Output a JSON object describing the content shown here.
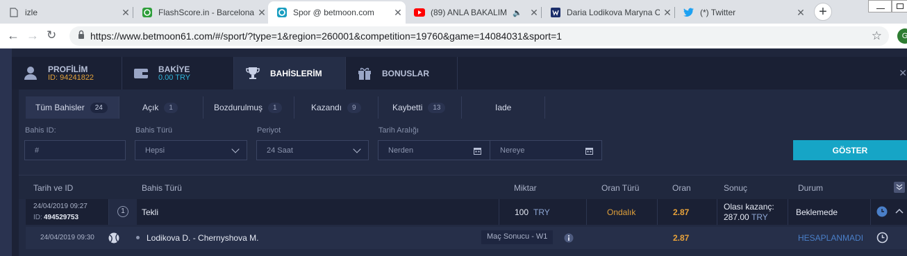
{
  "browser": {
    "tabs": [
      {
        "title": "izle",
        "icon": "page-icon"
      },
      {
        "title": "FlashScore.in - Barcelona",
        "icon": "flashscore-icon"
      },
      {
        "title": "Spor @ betmoon.com",
        "icon": "betmoon-icon",
        "active": true
      },
      {
        "title": "(89) ANLA BAKALIM",
        "icon": "youtube-icon",
        "audio": true
      },
      {
        "title": "Daria Lodikova Maryna C",
        "icon": "site-icon"
      },
      {
        "title": "(*) Twitter",
        "icon": "twitter-icon"
      }
    ],
    "url": "https://www.betmoon61.com/#/sport/?type=1&region=260001&competition=19760&game=14084031&sport=1",
    "profile_initial": "G"
  },
  "account_nav": {
    "profile": {
      "label": "PROFİLİM",
      "sub": "ID: 94241822"
    },
    "balance": {
      "label": "BAKİYE",
      "sub": "0.00 TRY"
    },
    "bets": {
      "label": "BAHİSLERİM"
    },
    "bonus": {
      "label": "BONUSLAR"
    }
  },
  "filter_tabs": [
    {
      "label": "Tüm Bahisler",
      "count": "24",
      "active": true
    },
    {
      "label": "Açık",
      "count": "1"
    },
    {
      "label": "Bozdurulmuş",
      "count": "1"
    },
    {
      "label": "Kazandı",
      "count": "9"
    },
    {
      "label": "Kaybetti",
      "count": "13"
    },
    {
      "label": "Iade",
      "count": ""
    }
  ],
  "filters": {
    "bet_id": {
      "label": "Bahis ID:",
      "placeholder": "#"
    },
    "bet_type": {
      "label": "Bahis Türü",
      "value": "Hepsi"
    },
    "period": {
      "label": "Periyot",
      "value": "24 Saat"
    },
    "date_range": {
      "label": "Tarih Aralığı",
      "from": "Nerden",
      "to": "Nereye"
    },
    "show_button": "GÖSTER"
  },
  "table": {
    "headers": {
      "date_id": "Tarih ve ID",
      "bet_type": "Bahis Türü",
      "amount": "Miktar",
      "odds_type": "Oran Türü",
      "odds": "Oran",
      "result": "Sonuç",
      "status": "Durum"
    },
    "bet": {
      "date": "24/04/2019 09:27",
      "id_label": "ID:",
      "id": "494529753",
      "number": "1",
      "type": "Tekli",
      "amount": "100",
      "currency": "TRY",
      "odds_type": "Ondalık",
      "odds": "2.87",
      "result_label": "Olası kazanç:",
      "result_value": "287.00",
      "result_currency": "TRY",
      "status": "Beklemede"
    },
    "selection": {
      "date": "24/04/2019 09:30",
      "match": "Lodikova D. - Chernyshova M.",
      "market": "Maç Sonucu - W1",
      "odds": "2.87",
      "status": "HESAPLANMADI"
    }
  },
  "colors": {
    "accent": "#16a5c6",
    "gold": "#e0a03a",
    "odds_orange": "#e8a23a",
    "status_blue": "#4a7fc8"
  }
}
